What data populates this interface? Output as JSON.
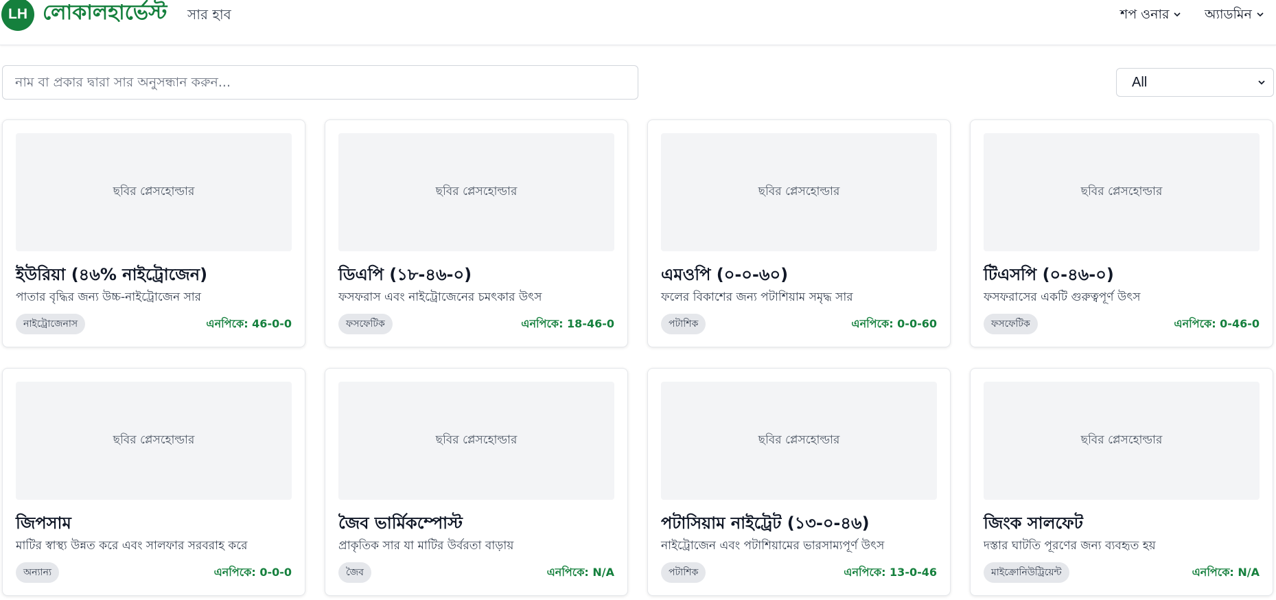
{
  "header": {
    "logo_initials": "LH",
    "brand_name": "লোকালহার্ভেস্ট",
    "brand_sub": "সার হাব",
    "nav": [
      {
        "label": "শপ ওনার"
      },
      {
        "label": "অ্যাডমিন"
      }
    ]
  },
  "search": {
    "placeholder": "নাম বা প্রকার দ্বারা সার অনুসন্ধান করুন...",
    "value": ""
  },
  "filter": {
    "selected": "All"
  },
  "npk_prefix": "এনপিকে:",
  "image_placeholder": "ছবির প্লেসহোল্ডার",
  "products": [
    {
      "title": "ইউরিয়া (৪৬% নাইট্রোজেন)",
      "description": "পাতার বৃদ্ধির জন্য উচ্চ-নাইট্রোজেন সার",
      "category": "নাইট্রোজেনাস",
      "npk": "এনপিকে: 46-0-0"
    },
    {
      "title": "ডিএপি (১৮-৪৬-০)",
      "description": "ফসফরাস এবং নাইট্রোজেনের চমৎকার উৎস",
      "category": "ফসফেটিক",
      "npk": "এনপিকে: 18-46-0"
    },
    {
      "title": "এমওপি (০-০-৬০)",
      "description": "ফলের বিকাশের জন্য পটাশিয়াম সমৃদ্ধ সার",
      "category": "পটাশিক",
      "npk": "এনপিকে: 0-0-60"
    },
    {
      "title": "টিএসপি (০-৪৬-০)",
      "description": "ফসফরাসের একটি গুরুত্বপূর্ণ উৎস",
      "category": "ফসফেটিক",
      "npk": "এনপিকে: 0-46-0"
    },
    {
      "title": "জিপসাম",
      "description": "মাটির স্বাস্থ্য উন্নত করে এবং সালফার সরবরাহ করে",
      "category": "অন্যান্য",
      "npk": "এনপিকে: 0-0-0"
    },
    {
      "title": "জৈব ভার্মিকম্পোস্ট",
      "description": "প্রাকৃতিক সার যা মাটির উর্বরতা বাড়ায়",
      "category": "জৈব",
      "npk": "এনপিকে: N/A"
    },
    {
      "title": "পটাসিয়াম নাইট্রেট (১৩-০-৪৬)",
      "description": "নাইট্রোজেন এবং পটাশিয়ামের ভারসাম্যপূর্ণ উৎস",
      "category": "পটাশিক",
      "npk": "এনপিকে: 13-0-46"
    },
    {
      "title": "জিংক সালফেট",
      "description": "দস্তার ঘাটতি পূরণের জন্য ব্যবহৃত হয়",
      "category": "মাইক্রোনিউট্রিয়েন্ট",
      "npk": "এনপিকে: N/A"
    }
  ],
  "colors": {
    "brand": "#15803d",
    "card_image_bg": "#f3f4f6",
    "badge_bg": "#e5e7eb"
  }
}
